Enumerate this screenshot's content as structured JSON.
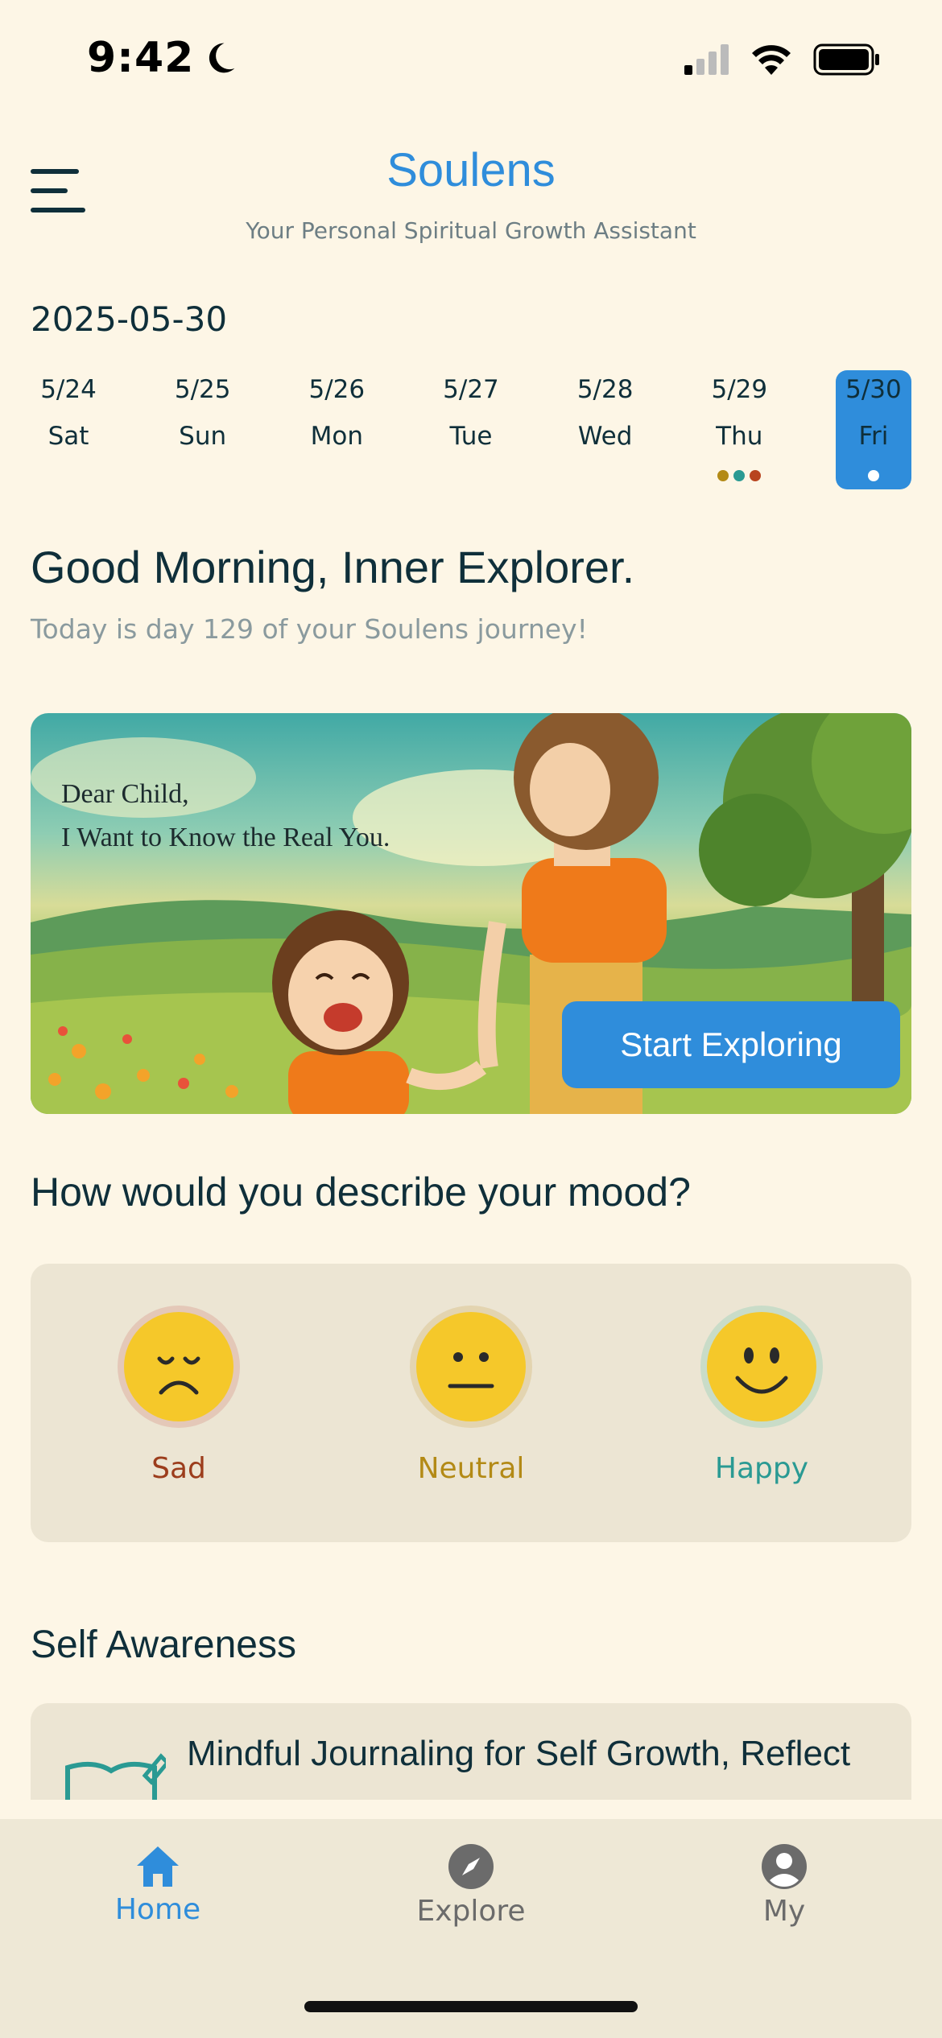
{
  "status": {
    "time": "9:42"
  },
  "header": {
    "title": "Soulens",
    "subtitle": "Your Personal Spiritual Growth Assistant"
  },
  "date_label": "2025-05-30",
  "week": [
    {
      "date": "5/24",
      "weekday": "Sat"
    },
    {
      "date": "5/25",
      "weekday": "Sun"
    },
    {
      "date": "5/26",
      "weekday": "Mon"
    },
    {
      "date": "5/27",
      "weekday": "Tue"
    },
    {
      "date": "5/28",
      "weekday": "Wed"
    },
    {
      "date": "5/29",
      "weekday": "Thu"
    },
    {
      "date": "5/30",
      "weekday": "Fri"
    }
  ],
  "greeting": {
    "title": "Good Morning, Inner Explorer.",
    "subtitle": "Today is day 129 of your Soulens journey!"
  },
  "banner": {
    "line1": "Dear Child,",
    "line2": "I Want to Know the Real You.",
    "button": "Start Exploring"
  },
  "mood": {
    "question": "How would you describe your mood?",
    "options": [
      {
        "label": "Sad",
        "color": "#9c3d1c"
      },
      {
        "label": "Neutral",
        "color": "#b38a16"
      },
      {
        "label": "Happy",
        "color": "#2a9a93"
      }
    ]
  },
  "self_awareness": {
    "title": "Self Awareness",
    "card_title": "Mindful Journaling for Self Growth, Reflect"
  },
  "tabs": [
    {
      "label": "Home",
      "color": "#2f8ddb"
    },
    {
      "label": "Explore",
      "color": "#6b6b6b"
    },
    {
      "label": "My",
      "color": "#6b6b6b"
    }
  ],
  "colors": {
    "accent": "#2f8ddb",
    "background": "#fdf6e6",
    "dot1": "#b38a16",
    "dot2": "#2a9a93",
    "dot3": "#b8441f"
  }
}
